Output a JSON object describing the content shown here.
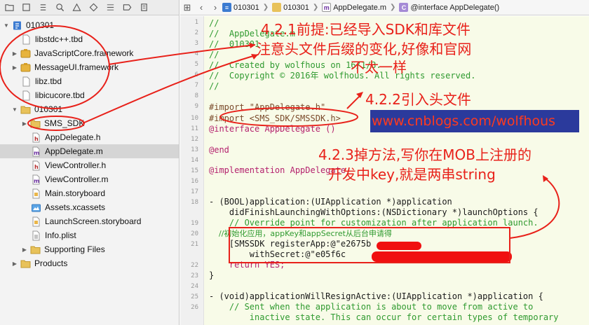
{
  "navigator": {
    "toolbar_icons": [
      "folder-icon",
      "warning-icon",
      "search-icon",
      "source-control-icon",
      "diamond-icon",
      "test-icon",
      "list-icon",
      "breakpoint-icon",
      "report-icon"
    ],
    "items": [
      {
        "label": "010301",
        "kind": "project"
      },
      {
        "label": "libstdc++.tbd",
        "kind": "file"
      },
      {
        "label": "JavaScriptCore.framework",
        "kind": "framework"
      },
      {
        "label": "MessageUI.framework",
        "kind": "framework"
      },
      {
        "label": "libz.tbd",
        "kind": "file"
      },
      {
        "label": "libicucore.tbd",
        "kind": "file"
      },
      {
        "label": "010301",
        "kind": "group"
      },
      {
        "label": "SMS_SDK",
        "kind": "group"
      },
      {
        "label": "AppDelegate.h",
        "kind": "header"
      },
      {
        "label": "AppDelegate.m",
        "kind": "implementation",
        "selected": true
      },
      {
        "label": "ViewController.h",
        "kind": "header"
      },
      {
        "label": "ViewController.m",
        "kind": "implementation"
      },
      {
        "label": "Main.storyboard",
        "kind": "storyboard"
      },
      {
        "label": "Assets.xcassets",
        "kind": "assets"
      },
      {
        "label": "LaunchScreen.storyboard",
        "kind": "storyboard"
      },
      {
        "label": "Info.plist",
        "kind": "plist"
      },
      {
        "label": "Supporting Files",
        "kind": "group"
      },
      {
        "label": "Products",
        "kind": "group"
      }
    ]
  },
  "jumpbar": {
    "project": "010301",
    "folder": "010301",
    "file": "AppDelegate.m",
    "symbol": "@interface AppDelegate()"
  },
  "editor": {
    "line_numbers": [
      "1",
      "2",
      "3",
      "4",
      "5",
      "6",
      "7",
      "8",
      "9",
      "10",
      "11",
      "12",
      "13",
      "14",
      "15",
      "16",
      "17",
      "18",
      "19",
      "20",
      "21",
      "22",
      "23",
      "24",
      "25",
      "26"
    ],
    "lines": [
      "//",
      "//  AppDelegate.m",
      "//  010301",
      "//",
      "//  Created by wolfhous on 16/1/3.",
      "//  Copyright © 2016年 wolfhous. All rights reserved.",
      "//",
      "",
      "#import \"AppDelegate.h\"",
      "#import <SMS_SDK/SMSSDK.h>",
      "@interface AppDelegate ()",
      "",
      "@end",
      "",
      "@implementation AppDelegate",
      "",
      "",
      "- (BOOL)application:(UIApplication *)application",
      "    didFinishLaunchingWithOptions:(NSDictionary *)launchOptions {",
      "    // Override point for customization after application launch.",
      "    //初始化应用，appKey和appSecret从后台申请得",
      "    [SMSSDK registerApp:@\"e2675b",
      "        withSecret:@\"e05f6c",
      "    return YES;",
      "}",
      "",
      "- (void)applicationWillResignActive:(UIApplication *)application {",
      "    // Sent when the application is about to move from active to",
      "        inactive state. This can occur for certain types of temporary"
    ]
  },
  "annotations": {
    "step1_line1": "4.2.1前提:已经导入SDK和库文件",
    "step1_line2": "注意头文件后缀的变化,好像和官网",
    "step1_line3": "不太一样",
    "step2": "4.2.2引入头文件",
    "step3_line1": "4.2.3掉方法,写你在MOB上注册的",
    "step3_line2": "开发中key,就是两串string",
    "watermark": "www.cnblogs.com/wolfhous",
    "annotation_color": "#e8211a",
    "watermark_bg": "#2b3a9c"
  }
}
